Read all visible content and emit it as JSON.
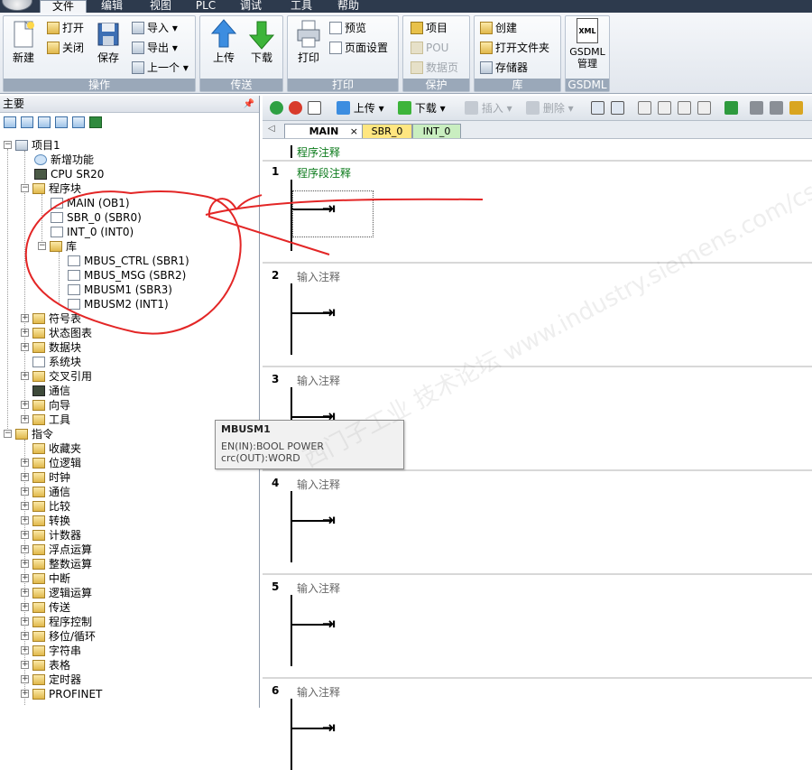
{
  "menu": {
    "items": [
      "文件",
      "编辑",
      "视图",
      "PLC",
      "调试",
      "工具",
      "帮助"
    ],
    "active": "文件"
  },
  "ribbon": {
    "groups": {
      "operate": {
        "caption": "操作",
        "new": "新建",
        "open": "打开",
        "close": "关闭",
        "save": "保存",
        "import": "导入",
        "export": "导出",
        "previous": "上一个"
      },
      "transfer": {
        "caption": "传送",
        "upload": "上传",
        "download": "下载"
      },
      "print": {
        "caption": "打印",
        "print": "打印",
        "preview": "预览",
        "page_setup": "页面设置"
      },
      "protect": {
        "caption": "保护",
        "project": "项目",
        "pou": "POU",
        "data_page": "数据页"
      },
      "library": {
        "caption": "库",
        "create": "创建",
        "open_folder": "打开文件夹",
        "memory": "存储器"
      },
      "gsdml": {
        "caption": "GSDML",
        "manage": "GSDML\n管理",
        "icon_text": "XML"
      }
    }
  },
  "left_pane": {
    "title": "主要",
    "tree": {
      "project": "项目1",
      "new_features": "新增功能",
      "cpu": "CPU SR20",
      "program_block": "程序块",
      "main": "MAIN (OB1)",
      "sbr0": "SBR_0 (SBR0)",
      "int0": "INT_0 (INT0)",
      "library": "库",
      "lib_items": [
        "MBUS_CTRL (SBR1)",
        "MBUS_MSG (SBR2)",
        "MBUSM1 (SBR3)",
        "MBUSM2 (INT1)"
      ],
      "symbol_table": "符号表",
      "status_chart": "状态图表",
      "data_block": "数据块",
      "system_block": "系统块",
      "cross_reference": "交叉引用",
      "communication": "通信",
      "wizard": "向导",
      "tools": "工具",
      "instructions": "指令",
      "instruction_items": [
        "收藏夹",
        "位逻辑",
        "时钟",
        "通信",
        "比较",
        "转换",
        "计数器",
        "浮点运算",
        "整数运算",
        "中断",
        "逻辑运算",
        "传送",
        "程序控制",
        "移位/循环",
        "字符串",
        "表格",
        "定时器",
        "PROFINET"
      ]
    }
  },
  "editor": {
    "toolbar": {
      "upload": "上传",
      "download": "下载",
      "insert": "插入",
      "delete": "删除"
    },
    "tabs": [
      {
        "label": "MAIN",
        "color": "#ffffff"
      },
      {
        "label": "SBR_0",
        "color": "#ffe680"
      },
      {
        "label": "INT_0",
        "color": "#c9eec0"
      }
    ],
    "program_comment": "程序注释",
    "networks": [
      {
        "num": "1",
        "comment": "程序段注释"
      },
      {
        "num": "2",
        "comment": "输入注释"
      },
      {
        "num": "3",
        "comment": "输入注释"
      },
      {
        "num": "4",
        "comment": "输入注释"
      },
      {
        "num": "5",
        "comment": "输入注释"
      },
      {
        "num": "6",
        "comment": "输入注释"
      }
    ]
  },
  "tooltip": {
    "title": "MBUSM1",
    "line1": "EN(IN):BOOL POWER",
    "line2": "crc(OUT):WORD"
  },
  "watermark": "西门子工业 技术论坛 www.industry.siemens.com/cs"
}
